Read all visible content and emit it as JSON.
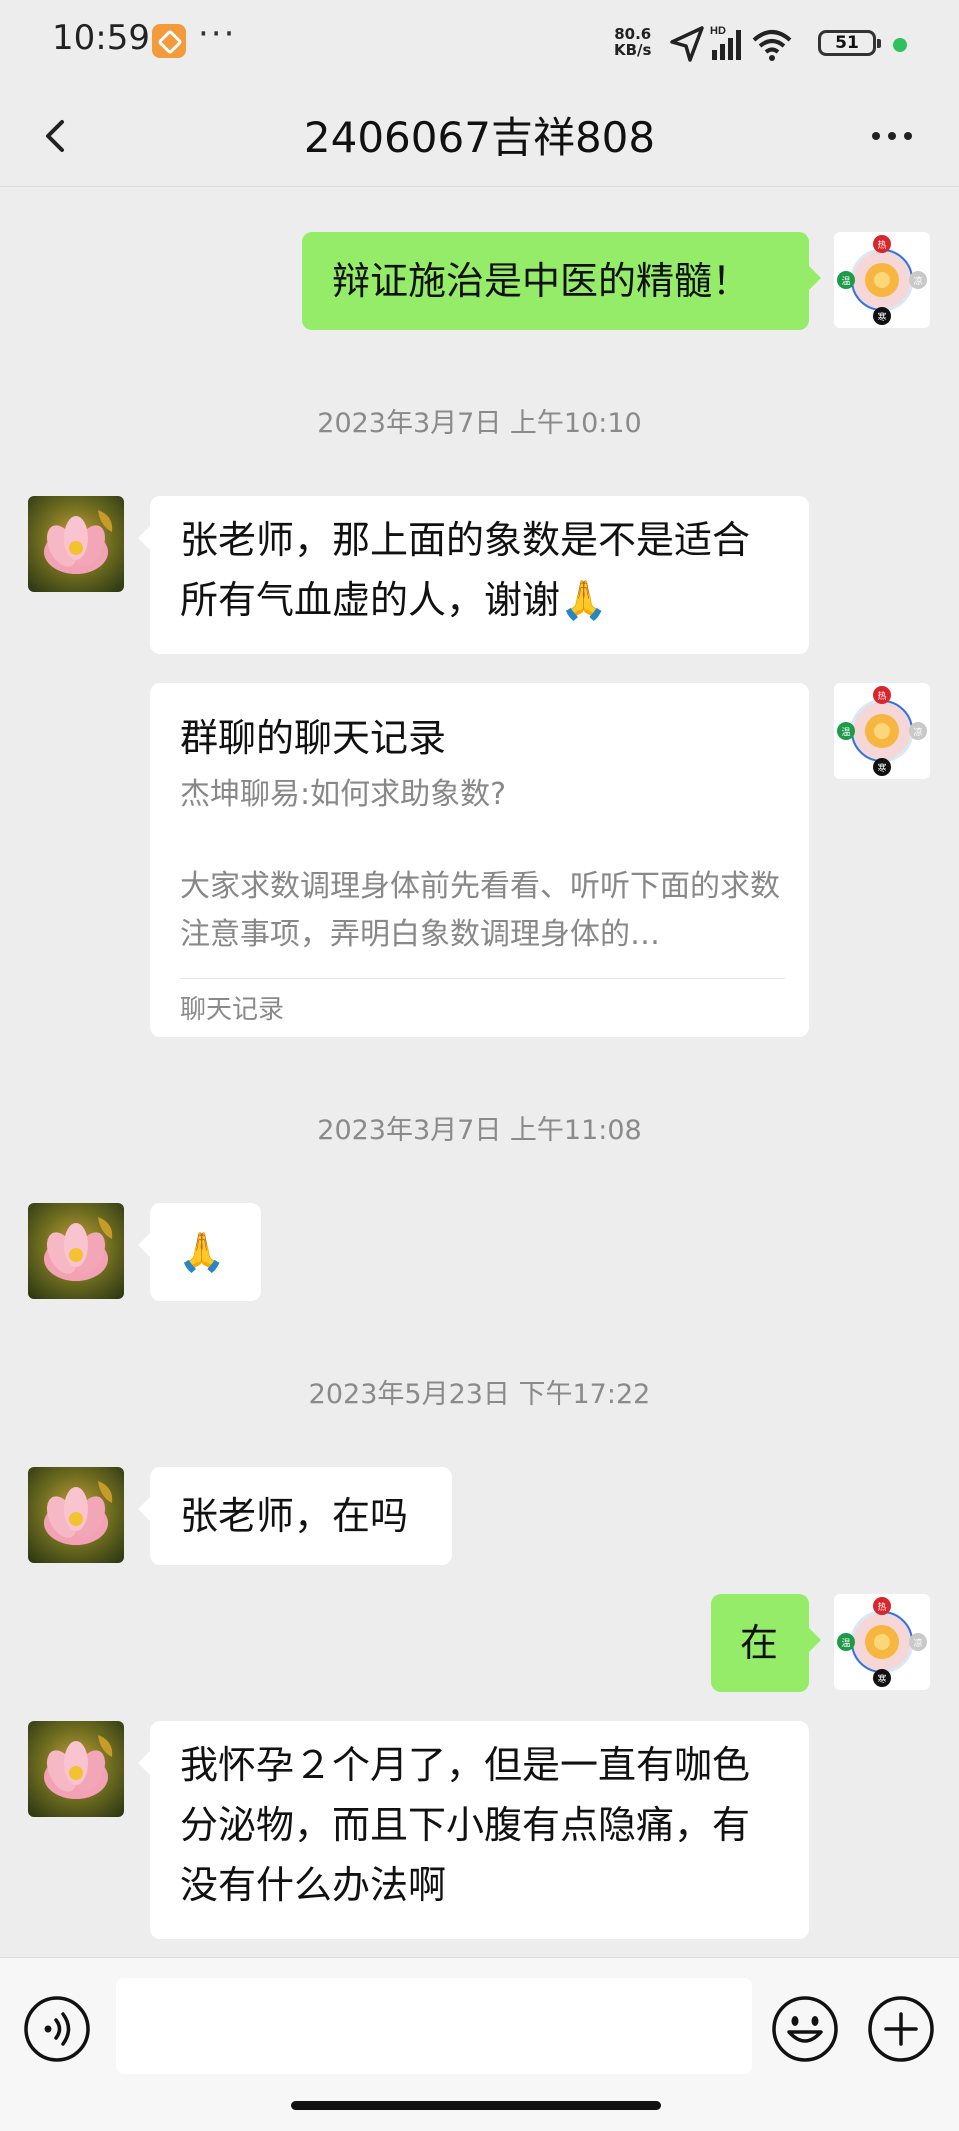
{
  "status_bar": {
    "time": "10:59",
    "more": "···",
    "net_speed_value": "80.6",
    "net_speed_unit": "KB/s",
    "battery": "51",
    "icons": [
      "app-notification-icon",
      "location-arrow-icon",
      "hd-signal-icon",
      "wifi-icon",
      "battery-icon"
    ]
  },
  "header": {
    "title": "2406067吉祥808",
    "back_icon": "chevron-left-icon",
    "more_icon": "more-horizontal-icon"
  },
  "messages": [
    {
      "type": "text",
      "side": "out",
      "text": "辩证施治是中医的精髓！"
    },
    {
      "type": "timestamp",
      "text": "2023年3月7日 上午10:10"
    },
    {
      "type": "text",
      "side": "in",
      "lines": [
        "张老师，那上面的象数是不是适合",
        "所有气血虚的人，谢谢🙏"
      ]
    },
    {
      "type": "card",
      "side": "out",
      "title": "群聊的聊天记录",
      "subtitle": "杰坤聊易:如何求助象数?",
      "body": "大家求数调理身体前先看看、听听下面的求数注意事项，弄明白象数调理身体的…",
      "footer": "聊天记录"
    },
    {
      "type": "timestamp",
      "text": "2023年3月7日 上午11:08"
    },
    {
      "type": "text",
      "side": "in",
      "text": "🙏"
    },
    {
      "type": "timestamp",
      "text": "2023年5月23日 下午17:22"
    },
    {
      "type": "text",
      "side": "in",
      "text": "张老师，在吗"
    },
    {
      "type": "text",
      "side": "out",
      "text": "在"
    },
    {
      "type": "text",
      "side": "in",
      "lines": [
        "我怀孕２个月了，但是一直有咖色",
        "分泌物，而且下小腹有点隐痛，有",
        "没有什么办法啊"
      ]
    }
  ],
  "avatars": {
    "contact": "lotus-flower-avatar",
    "self": "five-elements-diagram-avatar",
    "self_labels": [
      "热",
      "凉",
      "寒",
      "温"
    ]
  },
  "input_bar": {
    "placeholder": "",
    "voice_icon": "voice-icon",
    "emoji_icon": "emoji-icon",
    "plus_icon": "plus-icon"
  },
  "colors": {
    "background": "#ededed",
    "bubble_out": "#95ec69",
    "bubble_in": "#ffffff",
    "timestamp": "#8a8a8a"
  }
}
